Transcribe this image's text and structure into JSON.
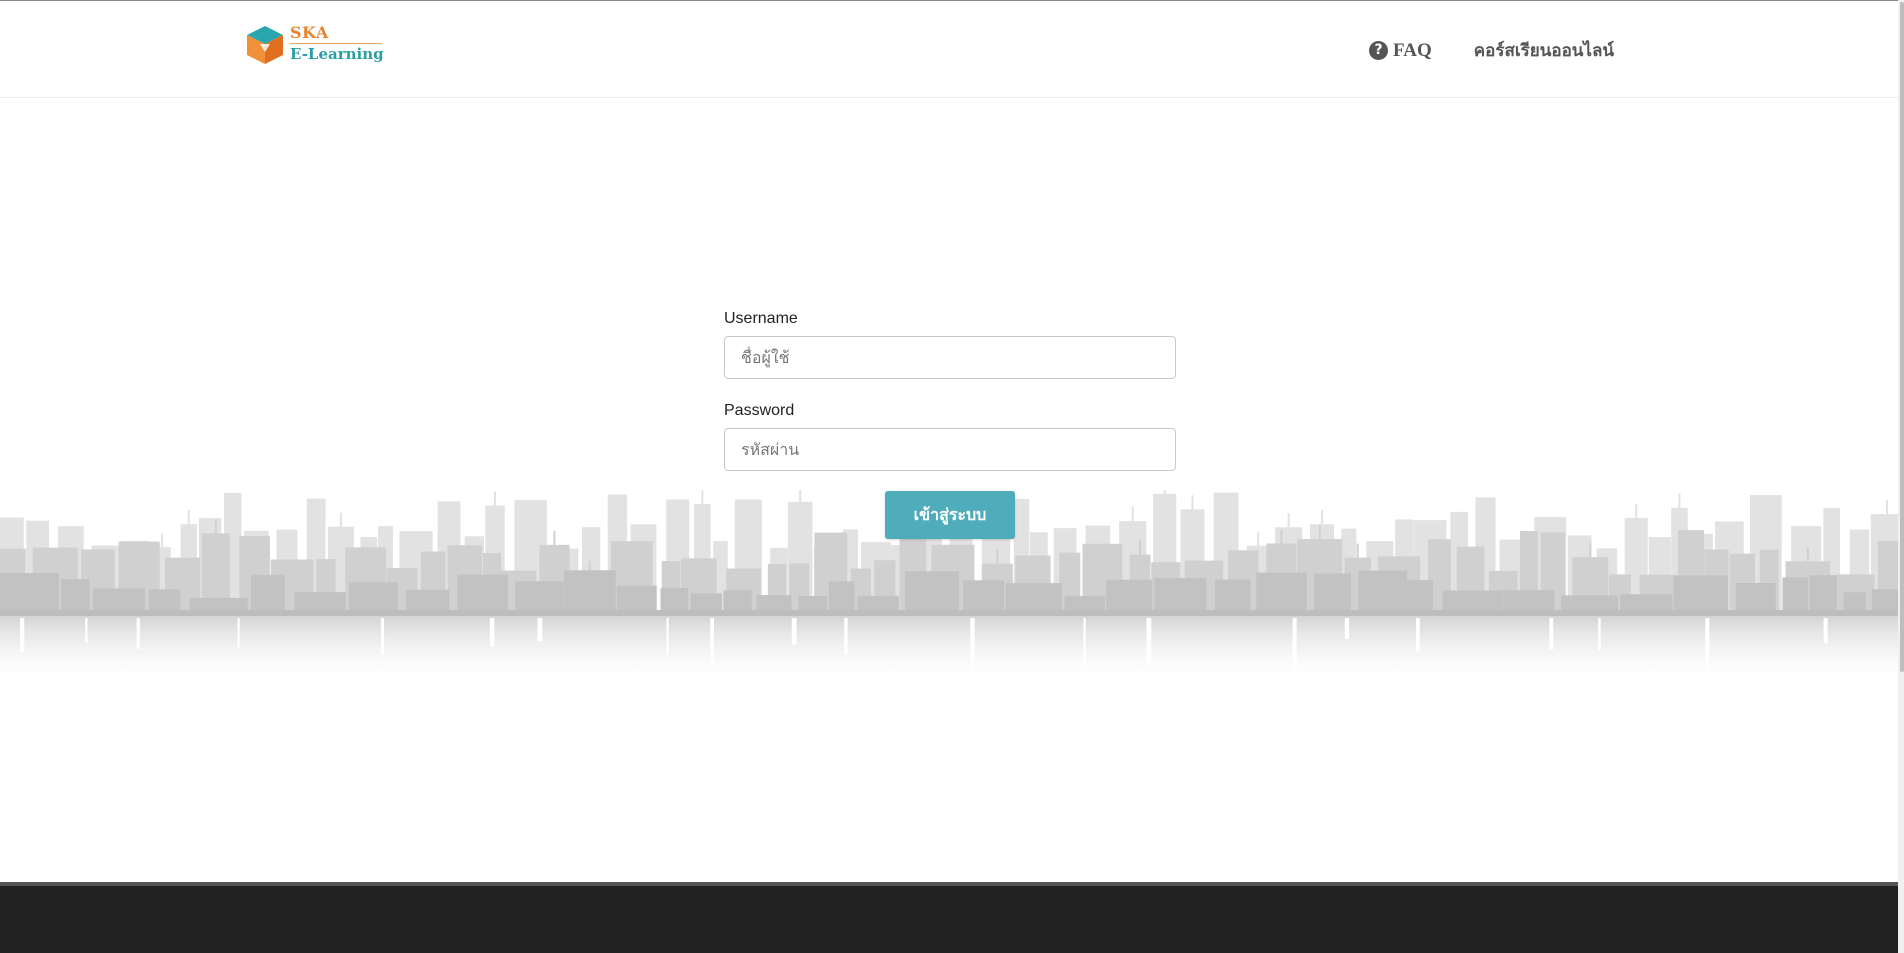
{
  "brand": {
    "name_top": "SKA",
    "name_bottom": "E-Learning",
    "colors": {
      "orange": "#e8842f",
      "teal": "#2a9fa5"
    }
  },
  "nav": {
    "items": [
      {
        "label": "FAQ",
        "icon": "question-circle-icon"
      },
      {
        "label": "คอร์สเรียนออนไลน์"
      }
    ]
  },
  "login": {
    "username_label": "Username",
    "username_placeholder": "ชื่อผู้ใช้",
    "password_label": "Password",
    "password_placeholder": "รหัสผ่าน",
    "submit_label": "เข้าสู่ระบบ",
    "button_color": "#4fadbb"
  },
  "footer": {
    "color": "#222222"
  }
}
